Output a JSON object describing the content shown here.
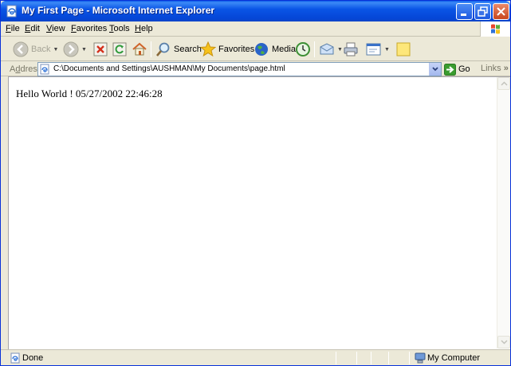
{
  "window": {
    "title": "My First Page - Microsoft Internet Explorer"
  },
  "menu": {
    "items": [
      {
        "label": "File",
        "accel": "F",
        "rest": "ile"
      },
      {
        "label": "Edit",
        "accel": "E",
        "rest": "dit"
      },
      {
        "label": "View",
        "accel": "V",
        "rest": "iew"
      },
      {
        "label": "Favorites",
        "accel": "F",
        "rest": "avorites"
      },
      {
        "label": "Tools",
        "accel": "T",
        "rest": "ools"
      },
      {
        "label": "Help",
        "accel": "H",
        "rest": "elp"
      }
    ]
  },
  "toolbar": {
    "back_label": "Back",
    "search_label": "Search",
    "favorites_label": "Favorites",
    "media_label": "Media"
  },
  "address": {
    "label": "Address",
    "accel": "d",
    "label_pre": "A",
    "label_post": "dress",
    "value": "C:\\Documents and Settings\\AUSHMAN\\My Documents\\page.html",
    "go_label": "Go",
    "links_label": "Links"
  },
  "content": {
    "text": "Hello World ! 05/27/2002 22:46:28"
  },
  "status": {
    "text": "Done",
    "zone": "My Computer"
  },
  "colors": {
    "titlebar": "#0a55e6",
    "chrome": "#ece9d8",
    "go_green": "#3a9c2f"
  }
}
